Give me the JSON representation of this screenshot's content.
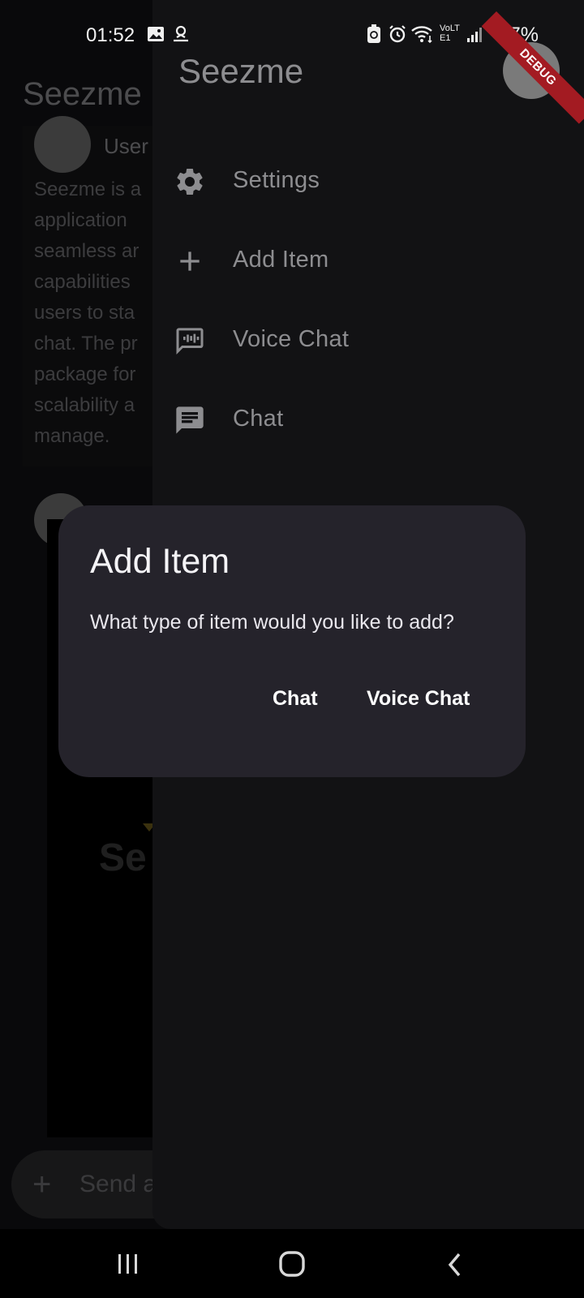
{
  "status_bar": {
    "time": "01:52",
    "network_label": "VoLTE1",
    "battery": "67%"
  },
  "debug_banner": "DEBUG",
  "background": {
    "app_title": "Seezme",
    "user_label": "User",
    "description_lines": "Seezme is a\napplication\nseamless ar\ncapabilities\nusers to sta\nchat. The pr\npackage for\nscalability a\nmanage.",
    "logo_text": "Se",
    "message_input_placeholder": "Send a"
  },
  "drawer": {
    "title": "Seezme",
    "items": [
      {
        "label": "Settings",
        "icon": "gear-icon"
      },
      {
        "label": "Add Item",
        "icon": "plus-icon"
      },
      {
        "label": "Voice Chat",
        "icon": "voice-chat-icon"
      },
      {
        "label": "Chat",
        "icon": "chat-icon"
      }
    ]
  },
  "dialog": {
    "title": "Add Item",
    "message": "What type of item would you like to add?",
    "buttons": [
      "Chat",
      "Voice Chat"
    ]
  },
  "colors": {
    "dialog_bg": "#25232b",
    "drawer_bg": "#121214",
    "debug_ribbon": "#a31b22"
  }
}
